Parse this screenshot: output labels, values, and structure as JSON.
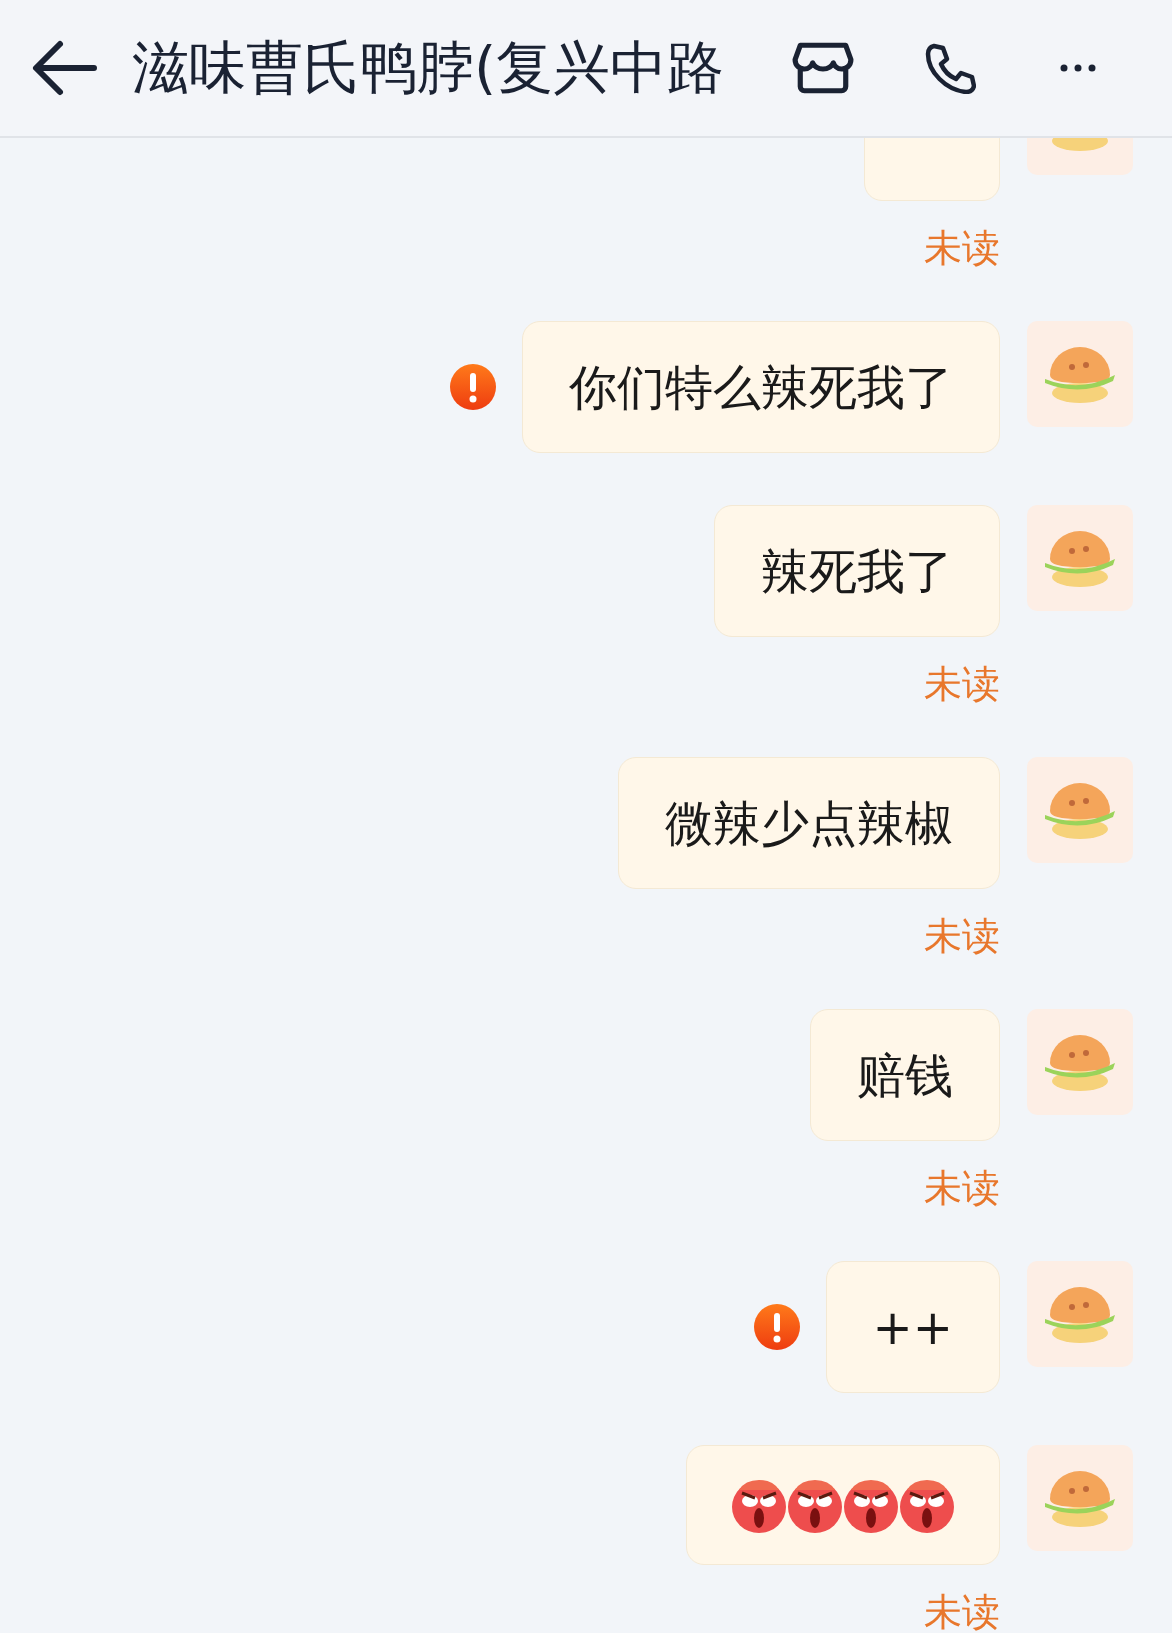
{
  "header": {
    "title": "滋味曹氏鸭脖(复兴中路"
  },
  "messages": [
    {
      "kind": "partial",
      "failed": false,
      "status": "未读"
    },
    {
      "kind": "text",
      "text": "你们特么辣死我了",
      "failed": true
    },
    {
      "kind": "text",
      "text": "辣死我了",
      "failed": false,
      "status": "未读"
    },
    {
      "kind": "text",
      "text": "微辣少点辣椒",
      "failed": false,
      "status": "未读"
    },
    {
      "kind": "text",
      "text": "赔钱",
      "failed": false,
      "status": "未读"
    },
    {
      "kind": "text",
      "text": "++",
      "failed": true
    },
    {
      "kind": "emoji",
      "emojis": [
        {
          "kind": "angry-face"
        },
        {
          "kind": "angry-face"
        },
        {
          "kind": "angry-face"
        },
        {
          "kind": "angry-face"
        }
      ],
      "failed": false,
      "status": "未读"
    }
  ]
}
